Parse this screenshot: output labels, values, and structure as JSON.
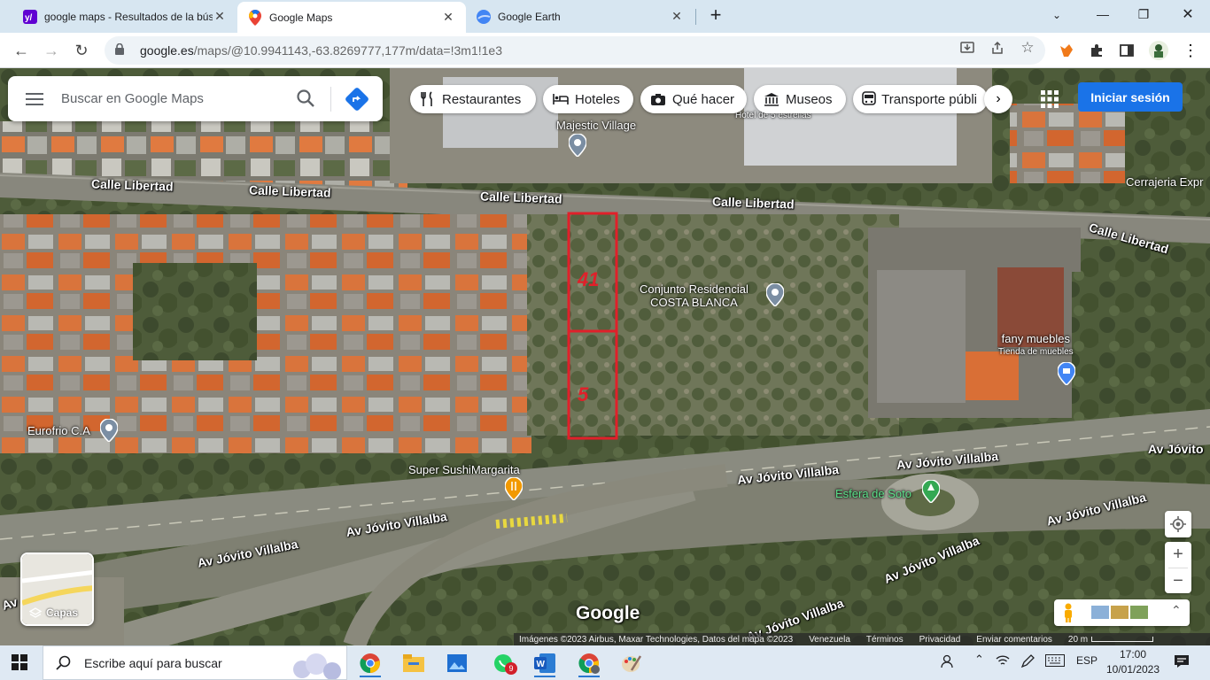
{
  "browser": {
    "tabs": [
      {
        "title": "google maps - Resultados de la bús",
        "favicon": "yahoo-icon",
        "active": false
      },
      {
        "title": "Google Maps",
        "favicon": "google-maps-icon",
        "active": true
      },
      {
        "title": "Google Earth",
        "favicon": "google-earth-icon",
        "active": false
      }
    ],
    "new_tab": "+",
    "url_domain": "google.es",
    "url_path": "/maps/@10.9941143,-63.8269777,177m/data=!3m1!1e3"
  },
  "maps": {
    "search_placeholder": "Buscar en Google Maps",
    "chips": [
      {
        "label": "Restaurantes",
        "icon": "fork-knife-icon"
      },
      {
        "label": "Hoteles",
        "icon": "bed-icon"
      },
      {
        "label": "Qué hacer",
        "icon": "camera-icon"
      },
      {
        "label": "Museos",
        "icon": "museum-icon"
      },
      {
        "label": "Transporte públi",
        "icon": "bus-icon"
      }
    ],
    "signin_label": "Iniciar sesión",
    "layers_label": "Capas",
    "google_logo": "Google",
    "streets": [
      {
        "text": "Calle Libertad"
      },
      {
        "text": "Calle Libertad"
      },
      {
        "text": "Calle Libertad"
      },
      {
        "text": "Calle Libertad"
      },
      {
        "text": "Calle Libertad"
      },
      {
        "text": "Av Jóvito Villalba"
      },
      {
        "text": "Av Jóvito Villalba"
      },
      {
        "text": "Av Jóvito Villalba"
      },
      {
        "text": "Av Jóvito Villalba"
      },
      {
        "text": "Av Jóvito Villalba"
      },
      {
        "text": "Av Jóvito Villalba"
      },
      {
        "text": "Av Jóvito Villalba"
      },
      {
        "text": "Av Jóvito Villalba"
      },
      {
        "text": "Av Jóvito"
      }
    ],
    "places": [
      {
        "name": "Majestic Village",
        "sub": ""
      },
      {
        "name": "Conjunto Residencial",
        "sub": "COSTA BLANCA"
      },
      {
        "name": "fany muebles",
        "sub": "Tienda de muebles"
      },
      {
        "name": "Eurofrio C.A",
        "sub": ""
      },
      {
        "name": "Super SushiMargarita",
        "sub": ""
      },
      {
        "name": "Esfera de Soto",
        "sub": ""
      },
      {
        "name": "Cerrajeria Expr",
        "sub": ""
      },
      {
        "name": "Hotel de 5 estrellas",
        "sub": ""
      }
    ],
    "lot_labels": [
      "41",
      "5"
    ],
    "attribution": [
      "Imágenes ©2023 Airbus, Maxar Technologies, Datos del mapa ©2023",
      "Venezuela",
      "Términos",
      "Privacidad",
      "Enviar comentarios",
      "20 m"
    ],
    "colors": {
      "accent": "#1a73e8",
      "lot_outline": "#e0202a"
    }
  },
  "taskbar": {
    "search_placeholder": "Escribe aquí para buscar",
    "whatsapp_badge": "9",
    "lang": "ESP",
    "time": "17:00",
    "date": "10/01/2023"
  }
}
